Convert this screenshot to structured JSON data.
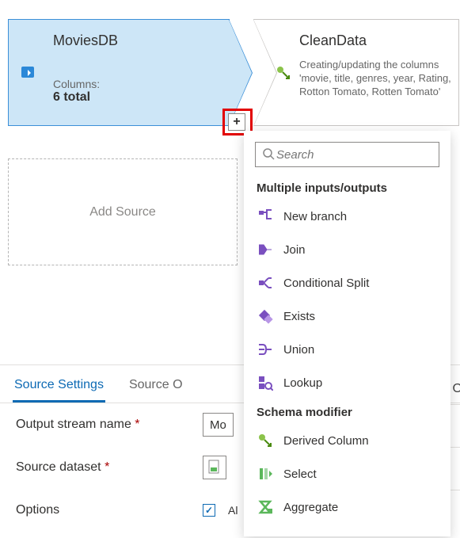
{
  "nodes": {
    "source": {
      "title": "MoviesDB",
      "columns_label": "Columns:",
      "columns_value": "6 total"
    },
    "derived": {
      "title": "CleanData",
      "description": "Creating/updating the columns 'movie, title, genres, year, Rating, Rotton Tomato, Rotten Tomato'"
    },
    "add_source": "Add Source"
  },
  "plus_tooltip": "+",
  "popup": {
    "search_placeholder": "Search",
    "group1_header": "Multiple inputs/outputs",
    "group1_items": [
      {
        "label": "New branch"
      },
      {
        "label": "Join"
      },
      {
        "label": "Conditional Split"
      },
      {
        "label": "Exists"
      },
      {
        "label": "Union"
      },
      {
        "label": "Lookup"
      }
    ],
    "group2_header": "Schema modifier",
    "group2_items": [
      {
        "label": "Derived Column"
      },
      {
        "label": "Select"
      },
      {
        "label": "Aggregate"
      }
    ]
  },
  "settings": {
    "tabs": {
      "active": "Source Settings",
      "other1": "Source O",
      "right": "O"
    },
    "output_stream_label": "Output stream name",
    "output_stream_value": "Mo",
    "dataset_label": "Source dataset",
    "options_label": "Options",
    "options_checkbox_text": "Al"
  },
  "colors": {
    "purple": "#7a4fbf",
    "green": "#5bb75b",
    "blue": "#2b88d8"
  }
}
